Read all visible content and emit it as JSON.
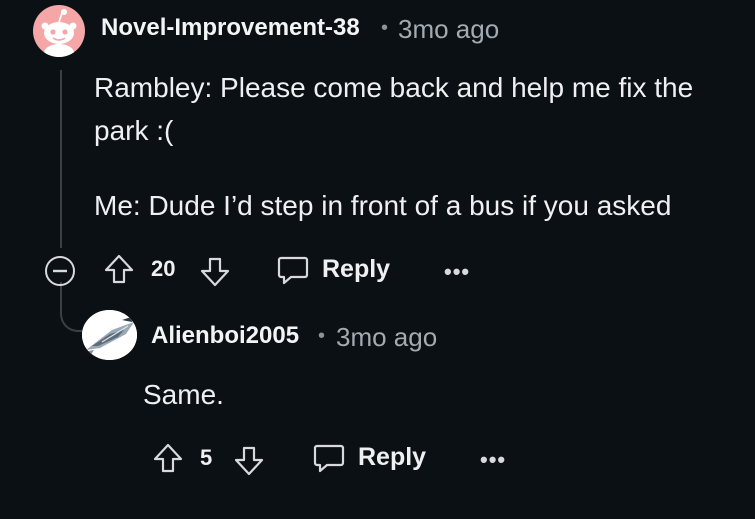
{
  "comment": {
    "author": "Novel-Improvement-38",
    "separator": "•",
    "time": "3mo ago",
    "lines": [
      "Rambley: Please come back and help me fix the",
      "park :(",
      "",
      "Me: Dude I’d step in front of a bus if you asked"
    ],
    "votes": "20",
    "reply_label": "Reply",
    "more_label": "•••",
    "avatar_icon": "reddit-snoo-avatar-icon",
    "collapse_icon": "collapse-minus-icon",
    "avatar_color": "#f4a7a6"
  },
  "reply": {
    "author": "Alienboi2005",
    "separator": "•",
    "time": "3mo ago",
    "text": "Same.",
    "votes": "5",
    "reply_label": "Reply",
    "more_label": "•••",
    "avatar_icon": "spaceship-avatar-icon"
  },
  "colors": {
    "background": "#0b1014",
    "text": "#eef0f2",
    "muted": "#a3abb1",
    "thread_line": "#3a4046"
  }
}
